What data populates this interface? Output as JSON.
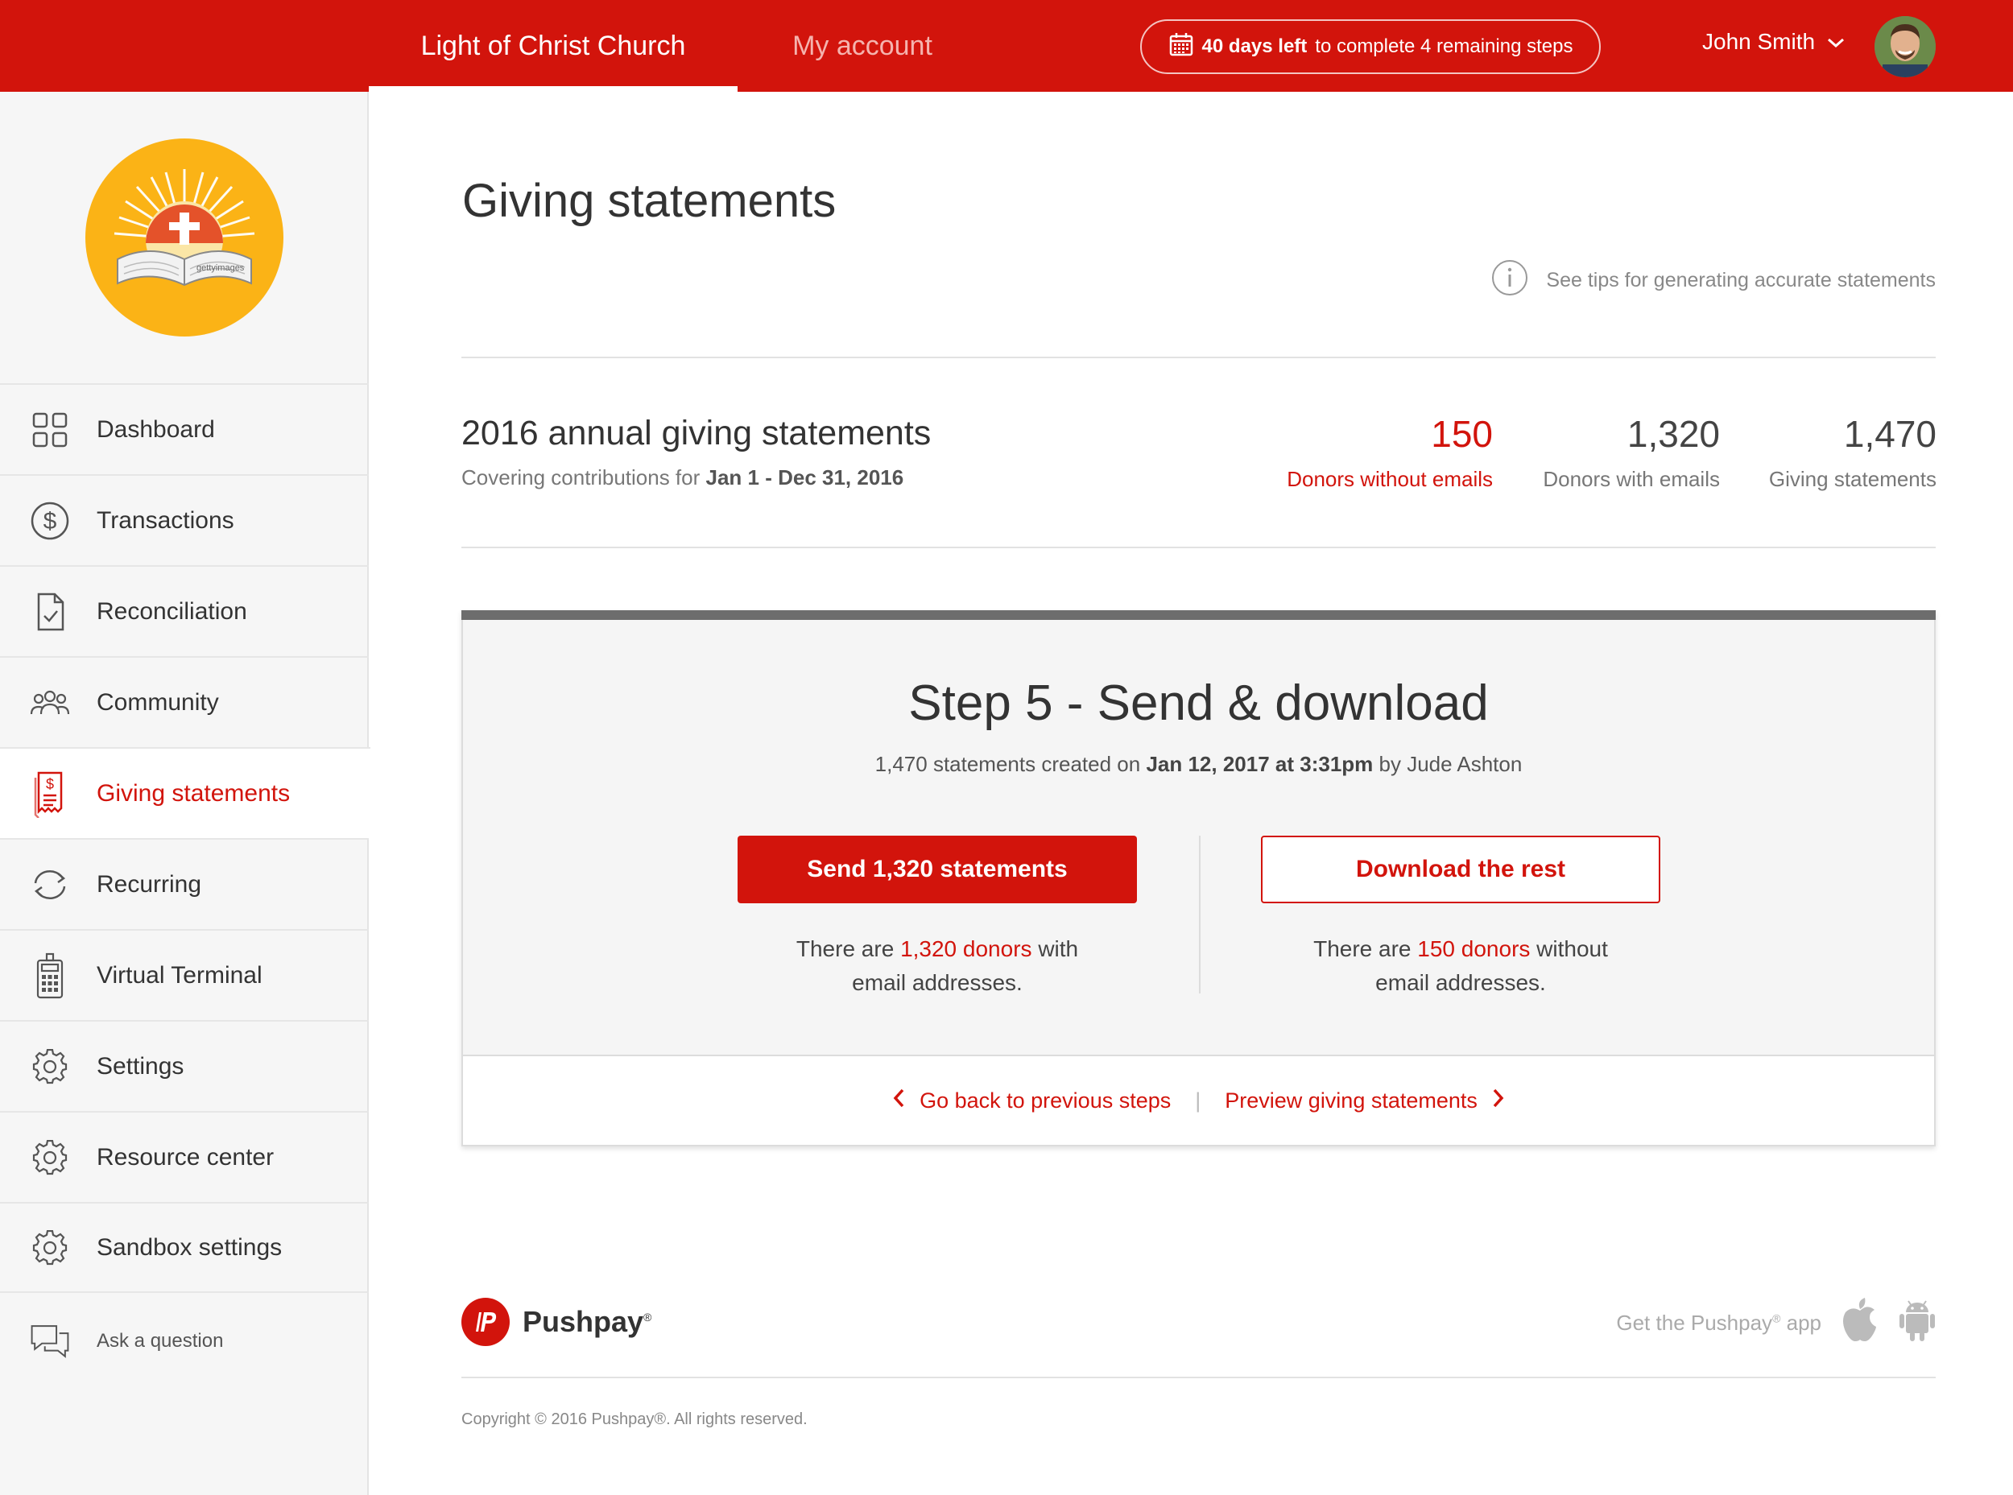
{
  "topbar": {
    "church_tab": "Light of Christ Church",
    "account_tab": "My account",
    "days_bold": "40 days left",
    "days_rest": "to complete 4 remaining steps",
    "user_name": "John Smith"
  },
  "sidebar": {
    "logo_watermark": "gettyimages",
    "items": [
      {
        "label": "Dashboard",
        "icon": "grid-icon"
      },
      {
        "label": "Transactions",
        "icon": "dollar-icon"
      },
      {
        "label": "Reconciliation",
        "icon": "document-check-icon"
      },
      {
        "label": "Community",
        "icon": "people-icon"
      },
      {
        "label": "Giving statements",
        "icon": "receipt-icon",
        "active": true
      },
      {
        "label": "Recurring",
        "icon": "refresh-icon"
      },
      {
        "label": "Virtual Terminal",
        "icon": "terminal-icon"
      },
      {
        "label": "Settings",
        "icon": "gear-icon"
      },
      {
        "label": "Resource center",
        "icon": "gear-icon"
      },
      {
        "label": "Sandbox settings",
        "icon": "gear-icon"
      }
    ],
    "ask_label": "Ask a question"
  },
  "main": {
    "title": "Giving statements",
    "tips_text": "See tips for generating accurate statements",
    "summary": {
      "title": "2016 annual giving statements",
      "covering_prefix": "Covering contributions for",
      "covering_range": "Jan 1 - Dec 31, 2016",
      "stats": [
        {
          "value": "150",
          "label": "Donors without emails"
        },
        {
          "value": "1,320",
          "label": "Donors with emails"
        },
        {
          "value": "1,470",
          "label": "Giving statements"
        }
      ]
    },
    "step": {
      "title": "Step 5 - Send & download",
      "created_prefix": "1,470 statements created on",
      "created_date": "Jan 12, 2017 at 3:31pm",
      "created_suffix": "by Jude Ashton",
      "send_button": "Send 1,320 statements",
      "download_button": "Download the rest",
      "send_note_pre": "There are",
      "send_note_link": "1,320 donors",
      "send_note_post": "with",
      "send_note_line2": "email addresses.",
      "download_note_pre": "There are",
      "download_note_link": "150 donors",
      "download_note_post": "without",
      "download_note_line2": "email addresses.",
      "back_link": "Go back to previous steps",
      "preview_link": "Preview giving statements",
      "footer_sep": "|"
    }
  },
  "footer": {
    "brand": "Pushpay",
    "get_app_pre": "Get the Pushpay",
    "get_app_post": " app",
    "reg_mark": "®",
    "copyright": "Copyright © 2016 Pushpay®. All rights reserved."
  },
  "colors": {
    "brand_red": "#d2140c",
    "tab_inactive": "#f5b3ae",
    "step_bar": "#6d6d6d"
  }
}
